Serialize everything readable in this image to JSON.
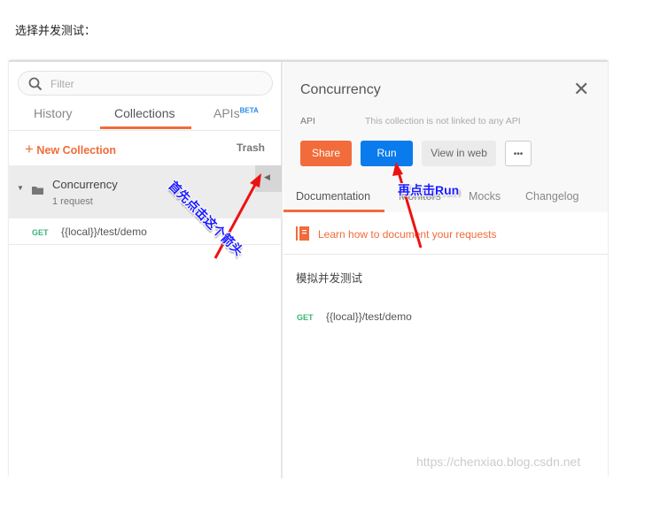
{
  "caption": "选择并发测试：",
  "sidebar": {
    "search_placeholder": "Filter",
    "tabs": [
      {
        "label": "History"
      },
      {
        "label": "Collections",
        "active": true
      },
      {
        "label": "APIs",
        "badge": "BETA"
      }
    ],
    "new_collection": "New Collection",
    "trash": "Trash",
    "collection": {
      "name": "Concurrency",
      "count": "1 request"
    },
    "request": {
      "method": "GET",
      "url": "{{local}}/test/demo"
    }
  },
  "panel": {
    "title": "Concurrency",
    "api_label": "API",
    "api_value": "This collection is not linked to any API",
    "buttons": {
      "share": "Share",
      "run": "Run",
      "view_web": "View in web",
      "more": "•••"
    },
    "tabs": [
      {
        "label": "Documentation",
        "active": true
      },
      {
        "label": "Monitors"
      },
      {
        "label": "Mocks"
      },
      {
        "label": "Changelog"
      }
    ],
    "learn_link": "Learn how to document your requests",
    "description": "模拟并发测试",
    "request": {
      "method": "GET",
      "url": "{{local}}/test/demo"
    }
  },
  "annotations": {
    "first": "首先点击这个箭头",
    "second": "再点击Run"
  },
  "watermark": "https://chenxiao.blog.csdn.net",
  "colors": {
    "accent": "#f26b3a",
    "run": "#097bed",
    "get": "#3ab57b",
    "annotation": "#1a1aff",
    "arrow": "#ee1111"
  }
}
